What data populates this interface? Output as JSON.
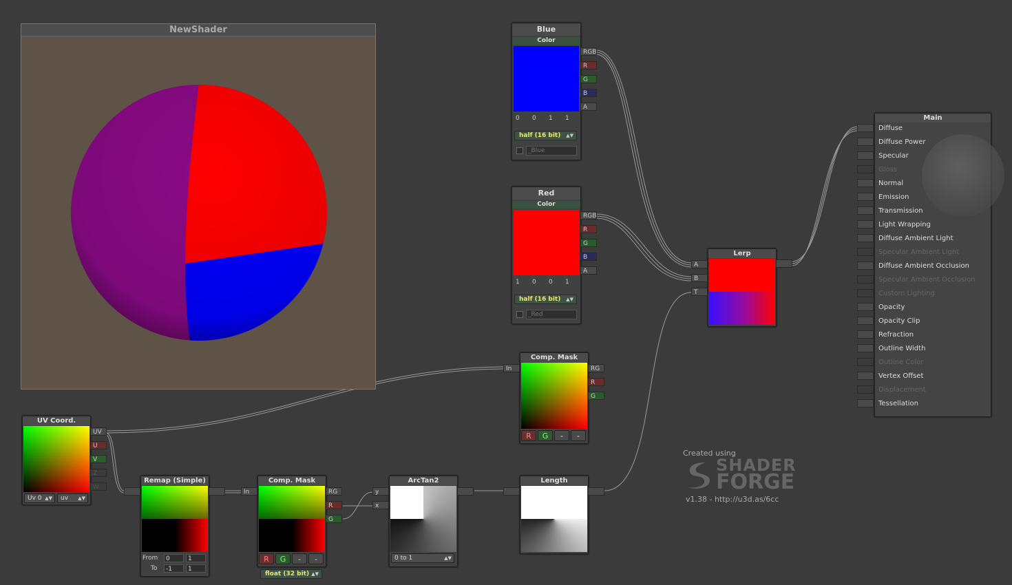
{
  "preview": {
    "title": "NewShader"
  },
  "blue_node": {
    "title": "Blue",
    "subtitle": "Color",
    "values": [
      "0",
      "0",
      "1",
      "1"
    ],
    "precision": "half (16 bit)",
    "prop_name": "_Blue"
  },
  "red_node": {
    "title": "Red",
    "subtitle": "Color",
    "values": [
      "1",
      "0",
      "0",
      "1"
    ],
    "precision": "half (16 bit)",
    "prop_name": "_Red"
  },
  "ports": {
    "rgb": "RGB",
    "r": "R",
    "g": "G",
    "b": "B",
    "a": "A",
    "in": "In",
    "rg": "RG",
    "uv": "UV",
    "u": "U",
    "v": "V",
    "z": "Z",
    "w": "W",
    "y": "y",
    "x": "x",
    "t": "T"
  },
  "lerp": {
    "title": "Lerp"
  },
  "comp_mask_top": {
    "title": "Comp. Mask",
    "btn_r": "R",
    "btn_g": "G",
    "btn_3": "-",
    "btn_4": "-"
  },
  "comp_mask_bottom": {
    "title": "Comp. Mask",
    "btn_r": "R",
    "btn_g": "G",
    "btn_3": "-",
    "btn_4": "-",
    "precision": "float (32 bit)"
  },
  "uv_node": {
    "title": "UV Coord.",
    "uv_set": "Uv 0",
    "uv_type": "uv"
  },
  "remap": {
    "title": "Remap (Simple)",
    "from_label": "From",
    "to_label": "To",
    "from_a": "0",
    "from_b": "1",
    "to_a": "-1",
    "to_b": "1"
  },
  "arctan": {
    "title": "ArcTan2",
    "mode": "0 to 1"
  },
  "length": {
    "title": "Length"
  },
  "main": {
    "title": "Main",
    "items": [
      {
        "label": "Diffuse",
        "enabled": true
      },
      {
        "label": "Diffuse Power",
        "enabled": true
      },
      {
        "label": "Specular",
        "enabled": true
      },
      {
        "label": "Gloss",
        "enabled": false
      },
      {
        "label": "Normal",
        "enabled": true
      },
      {
        "label": "Emission",
        "enabled": true
      },
      {
        "label": "Transmission",
        "enabled": true
      },
      {
        "label": "Light Wrapping",
        "enabled": true
      },
      {
        "label": "Diffuse Ambient Light",
        "enabled": true
      },
      {
        "label": "Specular Ambient Light",
        "enabled": false
      },
      {
        "label": "Diffuse Ambient Occlusion",
        "enabled": true
      },
      {
        "label": "Specular Ambient Occlusion",
        "enabled": false
      },
      {
        "label": "Custom Lighting",
        "enabled": false
      },
      {
        "label": "Opacity",
        "enabled": true
      },
      {
        "label": "Opacity Clip",
        "enabled": true
      },
      {
        "label": "Refraction",
        "enabled": true
      },
      {
        "label": "Outline Width",
        "enabled": true
      },
      {
        "label": "Outline Color",
        "enabled": false
      },
      {
        "label": "Vertex Offset",
        "enabled": true
      },
      {
        "label": "Displacement",
        "enabled": false
      },
      {
        "label": "Tessellation",
        "enabled": true
      }
    ]
  },
  "watermark": {
    "created": "Created using",
    "logo_line1": "SHADER",
    "logo_line2": "FORGE",
    "version": "v1.38 - http://u3d.as/6cc"
  },
  "colors": {
    "blue": "#0000ff",
    "red": "#ff0000",
    "purple": "#8a0a86",
    "preview_bg": "#5f5348"
  }
}
